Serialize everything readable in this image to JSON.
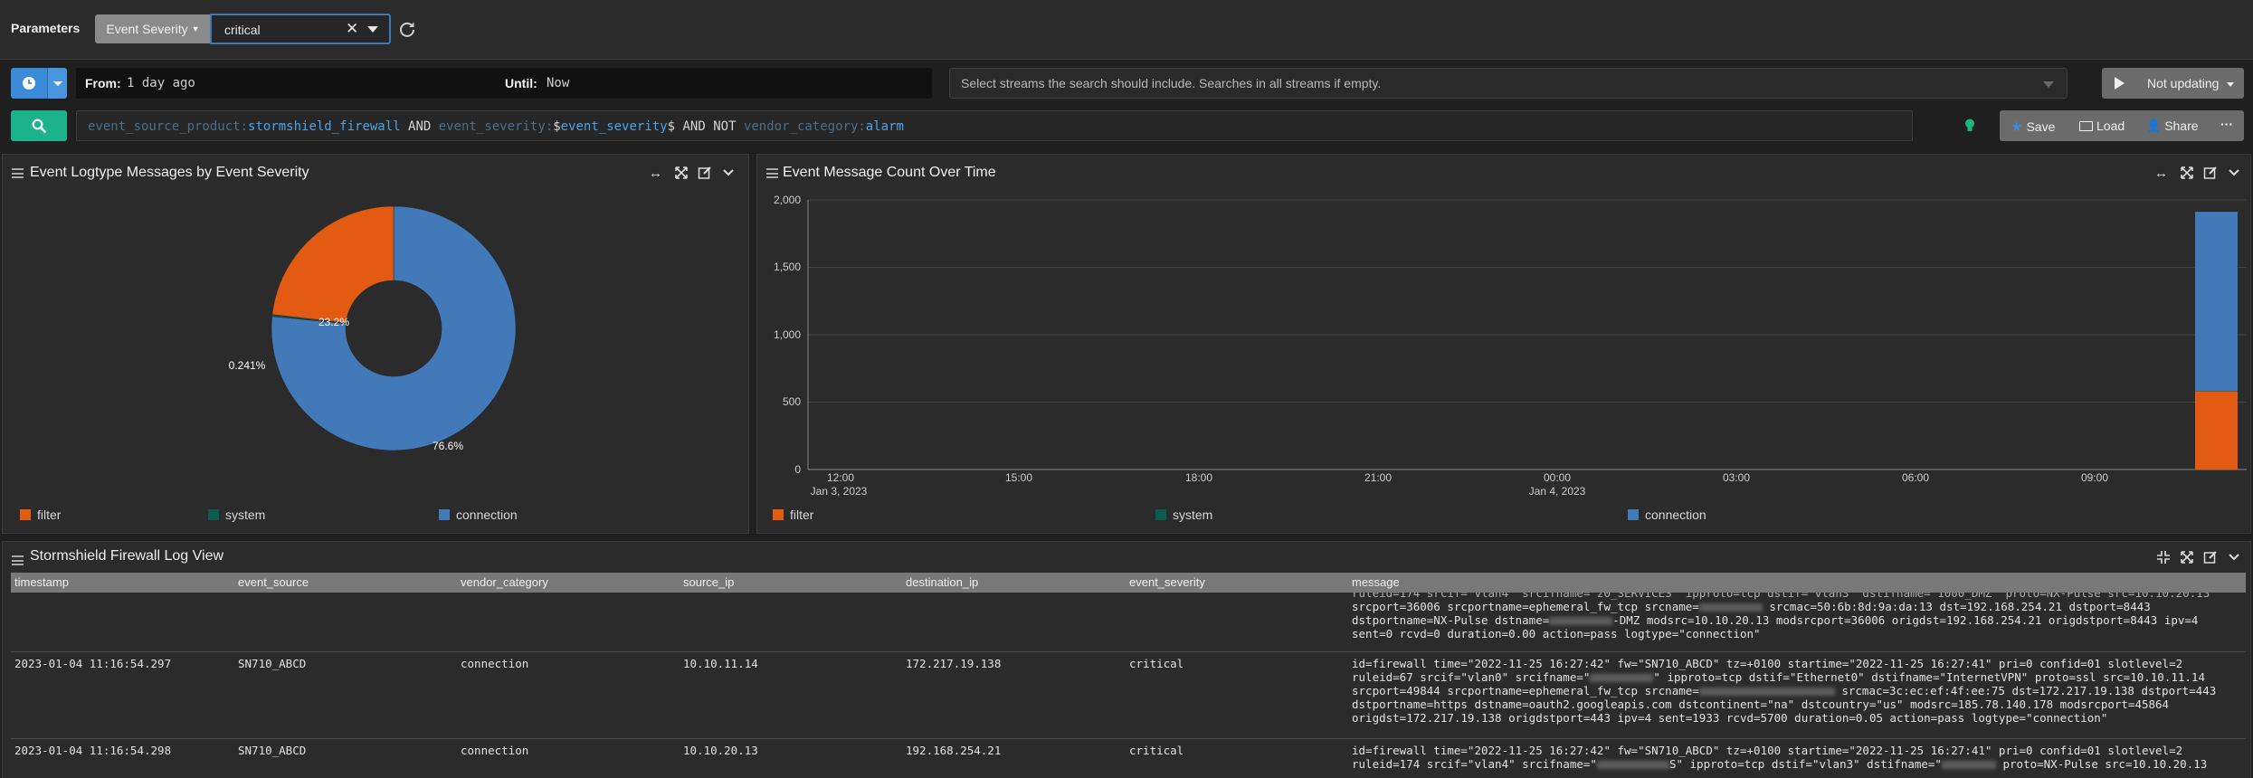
{
  "params": {
    "label": "Parameters",
    "param_name": "Event Severity",
    "param_value": "critical",
    "clear_glyph": "✕"
  },
  "time": {
    "from_label": "From:",
    "from_value": "1 day ago",
    "until_label": "Until:",
    "until_value": "Now"
  },
  "streams": {
    "placeholder": "Select streams the search should include. Searches in all streams if empty."
  },
  "updating": {
    "label": "Not updating"
  },
  "query": {
    "f1": "event_source_product:",
    "v1": "stormshield_firewall",
    "op1": " AND ",
    "f2": "event_severity:",
    "v2a": "$",
    "v2b": "event_severity",
    "v2c": "$",
    "op2": " AND NOT ",
    "f3": "vendor_category:",
    "v3": "alarm"
  },
  "actions": {
    "save": "Save",
    "load": "Load",
    "share": "Share",
    "more": "···"
  },
  "pie_widget": {
    "title": "Event Logtype Messages by Event Severity",
    "slice_labels": [
      "23.2%",
      "0.241%",
      "76.6%"
    ],
    "legend": [
      "filter",
      "system",
      "connection"
    ]
  },
  "count_widget": {
    "title": "Event Message Count Over Time",
    "y_ticks": [
      "2,000",
      "1,500",
      "1,000",
      "500",
      "0"
    ],
    "x_ticks": [
      "12:00",
      "15:00",
      "18:00",
      "21:00",
      "00:00",
      "03:00",
      "06:00",
      "09:00"
    ],
    "x_subticks": [
      "Jan 3, 2023",
      "Jan 4, 2023"
    ],
    "legend": [
      "filter",
      "system",
      "connection"
    ]
  },
  "colors": {
    "filter": "#e35a12",
    "system": "#0b5c4f",
    "connection": "#4279b8"
  },
  "chart_data": [
    {
      "type": "pie",
      "title": "Event Logtype Messages by Event Severity",
      "categories": [
        "filter",
        "system",
        "connection"
      ],
      "values": [
        23.2,
        0.241,
        76.6
      ],
      "legend_position": "bottom"
    },
    {
      "type": "bar",
      "title": "Event Message Count Over Time",
      "ylim": [
        0,
        2000
      ],
      "categories": [
        "Jan 4, 2023 11:00"
      ],
      "series": [
        {
          "name": "filter",
          "values": [
            580
          ]
        },
        {
          "name": "system",
          "values": [
            2
          ]
        },
        {
          "name": "connection",
          "values": [
            1330
          ]
        }
      ],
      "grid": true,
      "legend_position": "bottom"
    }
  ],
  "log_widget": {
    "title": "Stormshield Firewall Log View",
    "columns": [
      "timestamp",
      "event_source",
      "vendor_category",
      "source_ip",
      "destination_ip",
      "event_severity",
      "message"
    ],
    "partial_row": {
      "lines": [
        "ruleid=174 srcif=\"vlan4\" srcifname=\"z0_SERVICES\" ipproto=tcp dstif=\"vlan3\" dstifname=\"1000_DMZ\" proto=NX-Pulse src=10.10.20.13",
        "srcport=36006 srcportname=ephemeral_fw_tcp srcname=",
        "dstportname=NX-Pulse dstname=",
        "sent=0 rcvd=0 duration=0.00 action=pass logtype=\"connection\""
      ],
      "line2_tail": " srcmac=50:6b:8d:9a:da:13 dst=192.168.254.21 dstport=8443",
      "line3_tail": "-DMZ modsrc=10.10.20.13 modsrcport=36006 origdst=192.168.254.21 origdstport=8443 ipv=4"
    },
    "rows": [
      {
        "timestamp": "2023-01-04 11:16:54.297",
        "event_source": "SN710_ABCD",
        "vendor_category": "connection",
        "source_ip": "10.10.11.14",
        "destination_ip": "172.217.19.138",
        "event_severity": "critical",
        "l1": "id=firewall time=\"2022-11-25 16:27:42\" fw=\"SN710_ABCD\" tz=+0100 startime=\"2022-11-25 16:27:41\" pri=0 confid=01 slotlevel=2",
        "l2a": "ruleid=67 srcif=\"vlan0\" srcifname=\"",
        "l2b": "\" ipproto=tcp dstif=\"Ethernet0\" dstifname=\"InternetVPN\" proto=ssl src=10.10.11.14",
        "l3a": "srcport=49844 srcportname=ephemeral_fw_tcp srcname=",
        "l3b": " srcmac=3c:ec:ef:4f:ee:75 dst=172.217.19.138 dstport=443",
        "l4": "dstportname=https dstname=oauth2.googleapis.com dstcontinent=\"na\" dstcountry=\"us\" modsrc=185.78.140.178 modsrcport=45864",
        "l5": "origdst=172.217.19.138 origdstport=443 ipv=4 sent=1933 rcvd=5700 duration=0.05 action=pass logtype=\"connection\""
      },
      {
        "timestamp": "2023-01-04 11:16:54.298",
        "event_source": "SN710_ABCD",
        "vendor_category": "connection",
        "source_ip": "10.10.20.13",
        "destination_ip": "192.168.254.21",
        "event_severity": "critical",
        "l1": "id=firewall time=\"2022-11-25 16:27:42\" fw=\"SN710_ABCD\" tz=+0100 startime=\"2022-11-25 16:27:41\" pri=0 confid=01 slotlevel=2",
        "l2a": "ruleid=174 srcif=\"vlan4\" srcifname=\"",
        "l2b": "S\" ipproto=tcp dstif=\"vlan3\" dstifname=\"",
        "l2c": " proto=NX-Pulse src=10.10.20.13"
      }
    ]
  }
}
